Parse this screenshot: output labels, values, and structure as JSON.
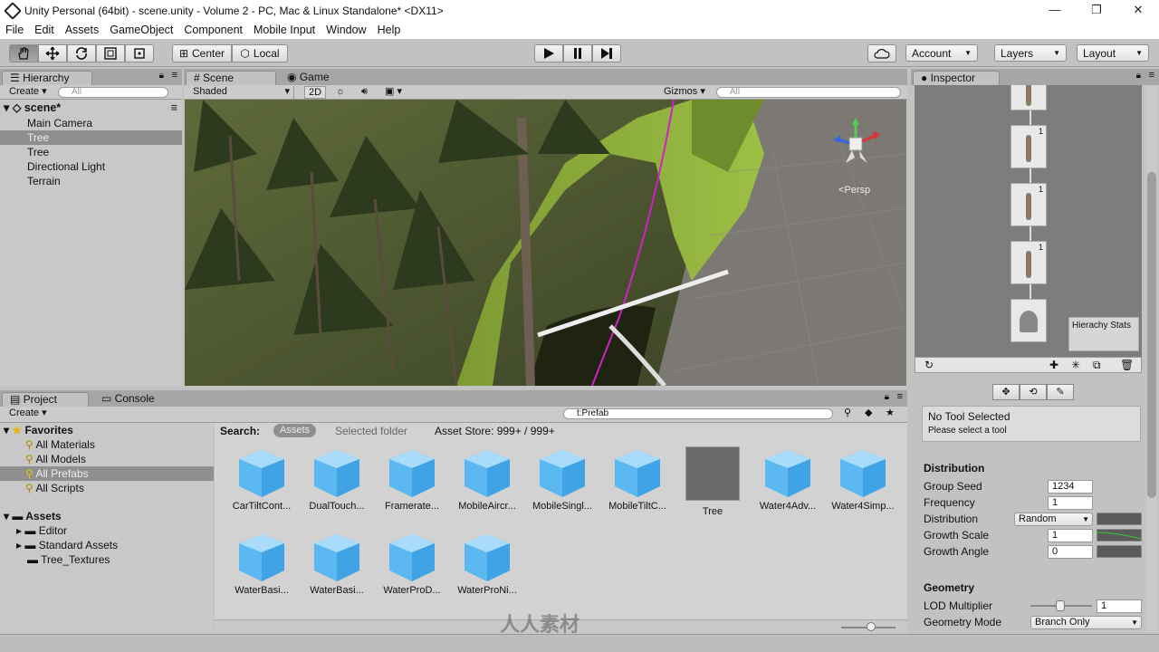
{
  "window": {
    "title": "Unity Personal (64bit) - scene.unity - Volume 2 - PC, Mac & Linux Standalone* <DX11>",
    "minimize": "—",
    "maximize": "❐",
    "close": "✕"
  },
  "menu": [
    "File",
    "Edit",
    "Assets",
    "GameObject",
    "Component",
    "Mobile Input",
    "Window",
    "Help"
  ],
  "toolbar": {
    "center": "Center",
    "local": "Local",
    "account": "Account",
    "layers": "Layers",
    "layout": "Layout"
  },
  "hierarchy": {
    "tab": "Hierarchy",
    "create": "Create",
    "search_placeholder": "All",
    "scene": "scene*",
    "items": [
      "Main Camera",
      "Tree",
      "Tree",
      "Directional Light",
      "Terrain"
    ],
    "selected_index": 1
  },
  "scene": {
    "tab_scene": "Scene",
    "tab_game": "Game",
    "shaded": "Shaded",
    "twod": "2D",
    "gizmos": "Gizmos",
    "search_placeholder": "All",
    "persp": "Persp"
  },
  "project": {
    "tab_project": "Project",
    "tab_console": "Console",
    "create": "Create",
    "search_value": "t:Prefab",
    "favorites": "Favorites",
    "fav_items": [
      "All Materials",
      "All Models",
      "All Prefabs",
      "All Scripts"
    ],
    "fav_selected": 2,
    "assets": "Assets",
    "asset_folders": [
      "Editor",
      "Standard Assets",
      "Tree_Textures"
    ],
    "search_label": "Search:",
    "scope_assets": "Assets",
    "scope_selected": "Selected folder",
    "scope_store": "Asset Store: 999+ / 999+",
    "items": [
      "CarTiltCont...",
      "DualTouch...",
      "Framerate...",
      "MobileAircr...",
      "MobileSingl...",
      "MobileTiltC...",
      "Tree",
      "Water4Adv...",
      "Water4Simp...",
      "WaterBasi...",
      "WaterBasi...",
      "WaterProD...",
      "WaterProNi..."
    ]
  },
  "inspector": {
    "tab": "Inspector",
    "hierarchy_stats": "Hierachy Stats",
    "no_tool": "No Tool Selected",
    "select_tool": "Please select a tool",
    "distribution_header": "Distribution",
    "props": [
      {
        "label": "Group Seed",
        "value": "1234"
      },
      {
        "label": "Frequency",
        "value": "1"
      },
      {
        "label": "Distribution",
        "value": "Random"
      },
      {
        "label": "Growth Scale",
        "value": "1"
      },
      {
        "label": "Growth Angle",
        "value": "0"
      }
    ],
    "geometry_header": "Geometry",
    "lod_label": "LOD Multiplier",
    "lod_value": "1",
    "geom_mode_label": "Geometry Mode",
    "geom_mode_value": "Branch Only",
    "node_counts": [
      "1",
      "1",
      "1"
    ]
  },
  "watermark": "人人素材"
}
